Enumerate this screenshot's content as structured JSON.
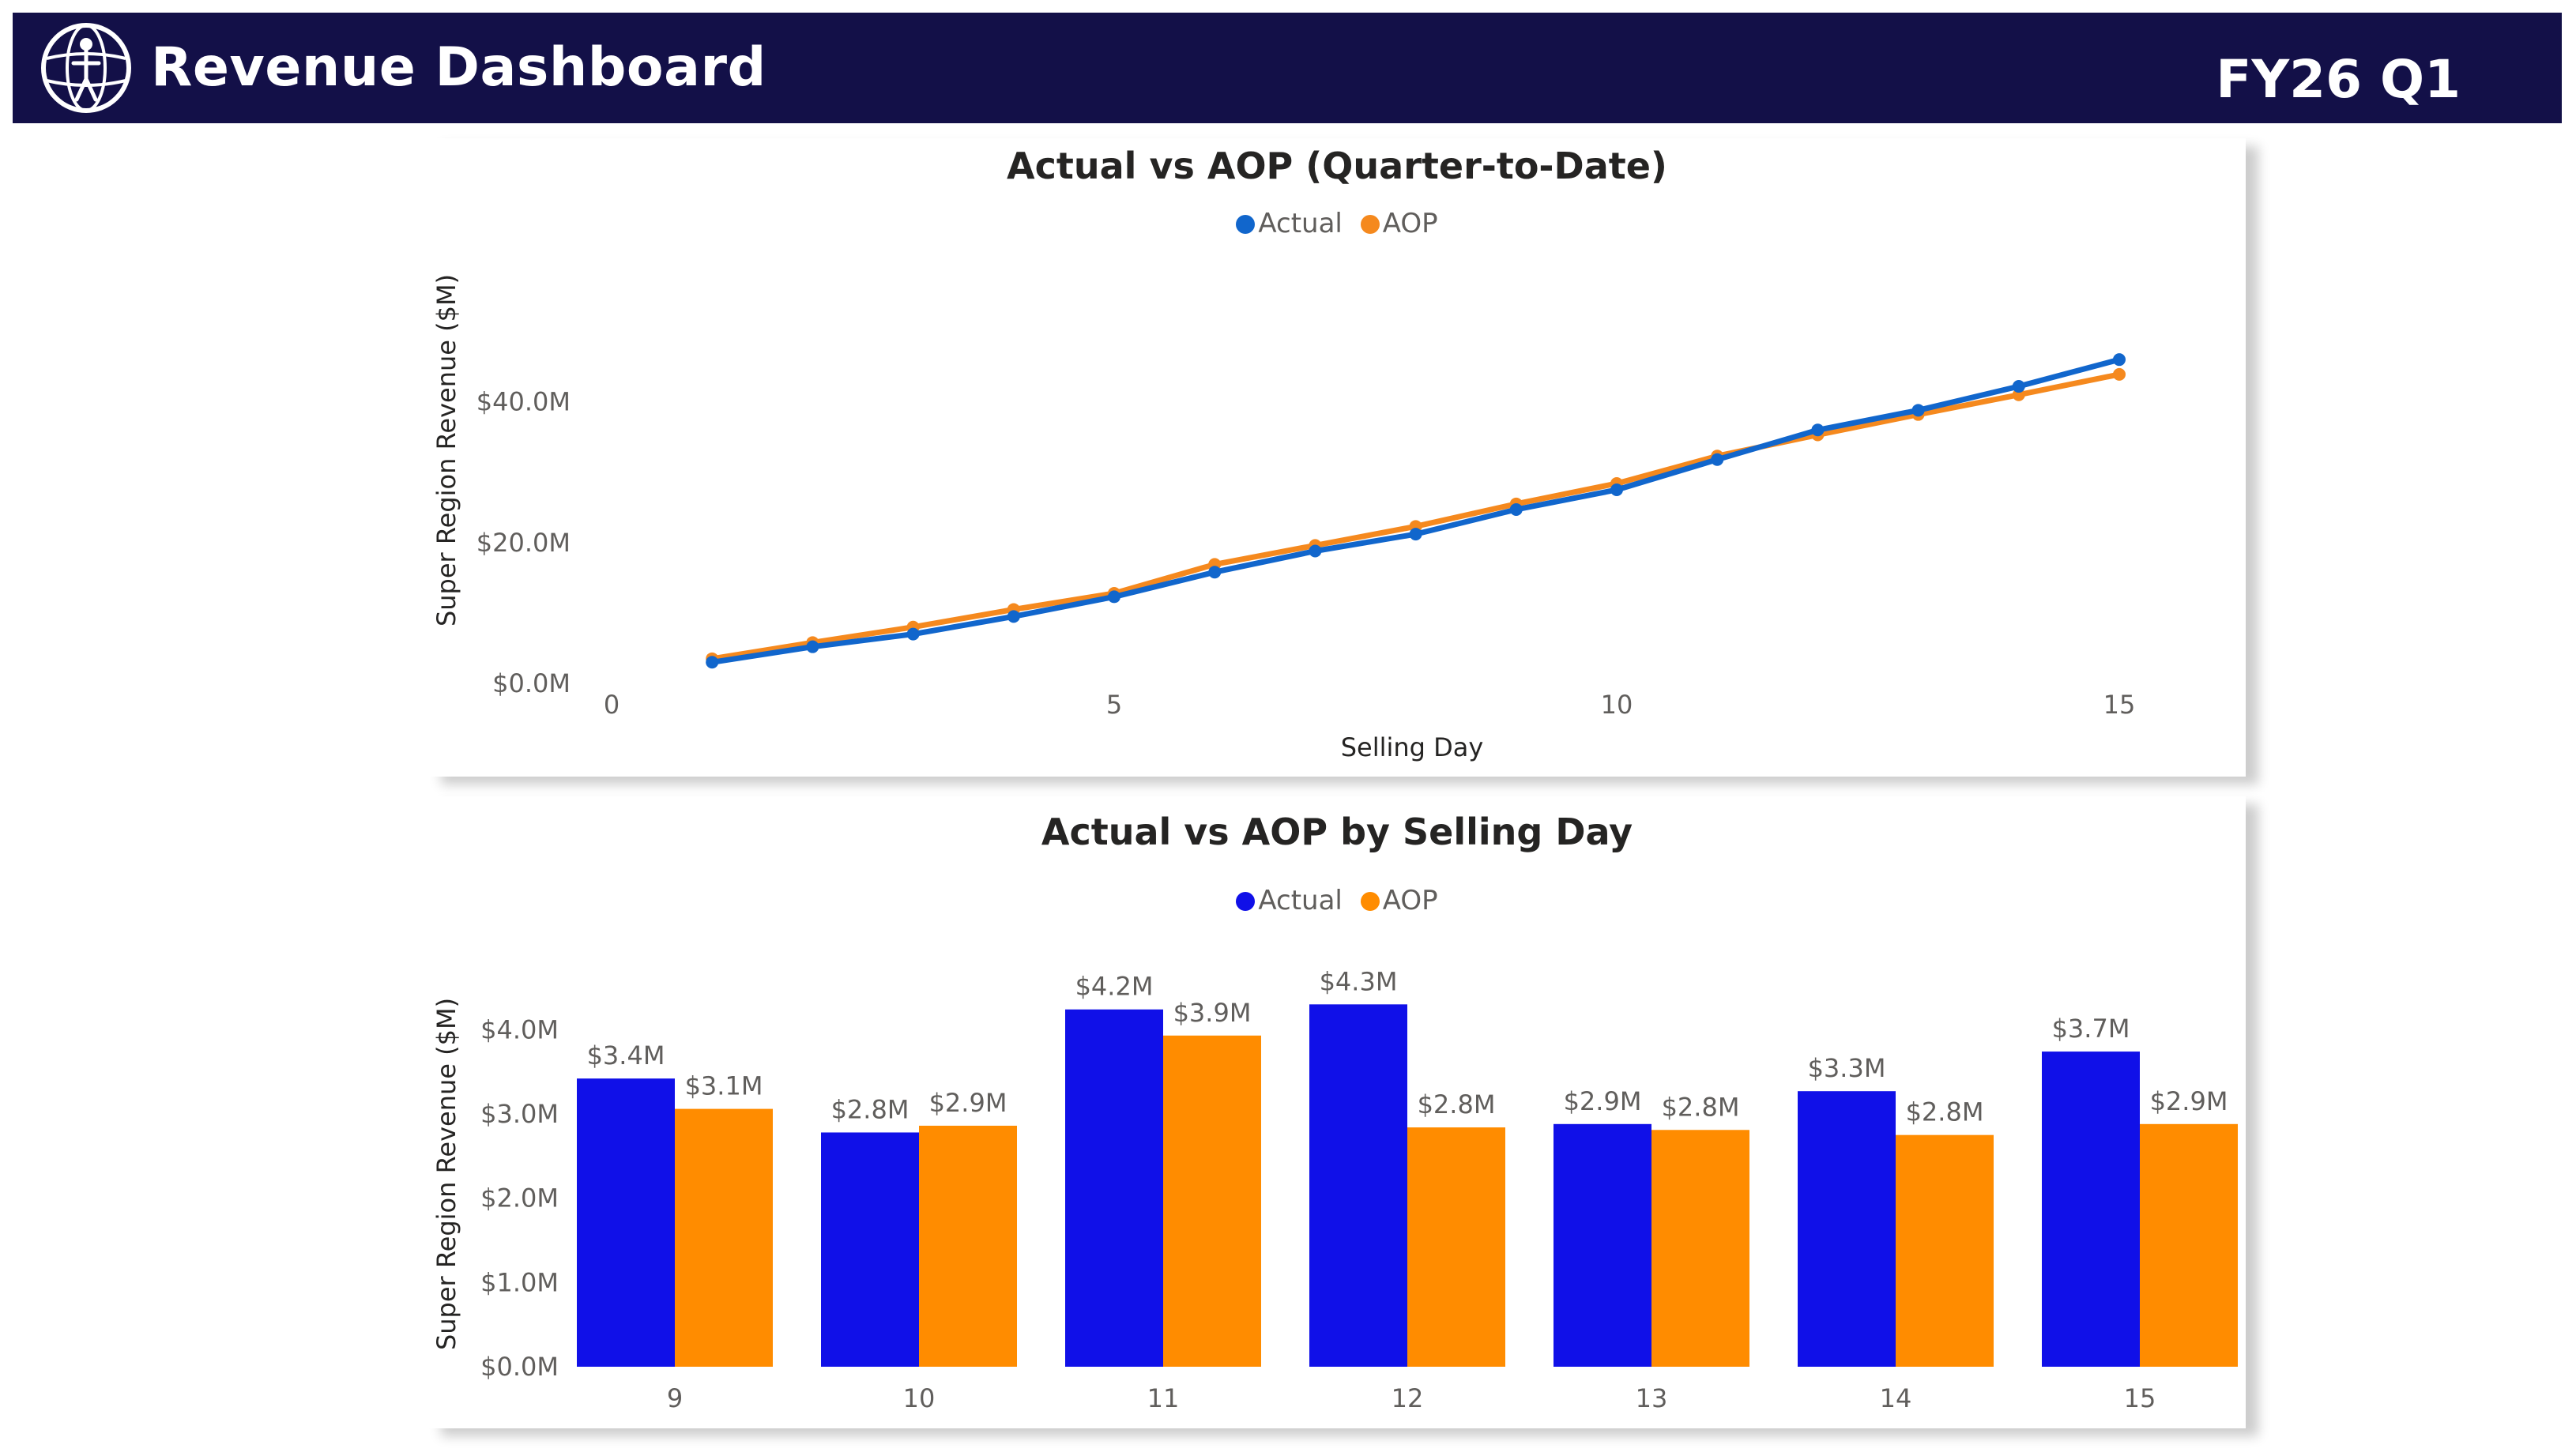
{
  "header": {
    "title": "Revenue Dashboard",
    "period": "FY26 Q1",
    "logo_icon": "globe-figure-logo-icon"
  },
  "colors": {
    "header_bg": "#131048",
    "line_actual": "#1166cc",
    "line_aop": "#f5891e",
    "bar_actual": "#1010e8",
    "bar_aop": "#ff8c00"
  },
  "chart_data": [
    {
      "type": "line",
      "title": "Actual vs AOP (Quarter-to-Date)",
      "xlabel": "Selling Day",
      "ylabel": "Super Region Revenue ($M)",
      "legend_position": "top-center",
      "x": [
        1,
        2,
        3,
        4,
        5,
        6,
        7,
        8,
        9,
        10,
        11,
        12,
        13,
        14,
        15
      ],
      "xlim": [
        0,
        15
      ],
      "xticks": [
        "0",
        "5",
        "10",
        "15"
      ],
      "ylim": [
        0,
        55
      ],
      "yticks": [
        "$0.0M",
        "$20.0M",
        "$40.0M"
      ],
      "series": [
        {
          "name": "Actual",
          "values": [
            3.0,
            5.2,
            7.0,
            9.5,
            12.3,
            15.8,
            18.8,
            21.2,
            24.7,
            27.5,
            31.8,
            36.0,
            38.8,
            42.2,
            46.0
          ]
        },
        {
          "name": "AOP",
          "values": [
            3.5,
            5.8,
            8.0,
            10.5,
            12.8,
            16.9,
            19.6,
            22.3,
            25.5,
            28.4,
            32.3,
            35.3,
            38.2,
            41.0,
            43.9
          ]
        }
      ]
    },
    {
      "type": "bar",
      "title": "Actual vs AOP by Selling Day",
      "xlabel": "",
      "ylabel": "Super Region Revenue ($M)",
      "legend_position": "top-center",
      "categories": [
        "9",
        "10",
        "11",
        "12",
        "13",
        "14",
        "15"
      ],
      "ylim": [
        0,
        4.8
      ],
      "yticks": [
        "$0.0M",
        "$1.0M",
        "$2.0M",
        "$3.0M",
        "$4.0M"
      ],
      "series": [
        {
          "name": "Actual",
          "values": [
            3.42,
            2.78,
            4.24,
            4.3,
            2.88,
            3.27,
            3.74
          ],
          "labels": [
            "$3.4M",
            "$2.8M",
            "$4.2M",
            "$4.3M",
            "$2.9M",
            "$3.3M",
            "$3.7M"
          ]
        },
        {
          "name": "AOP",
          "values": [
            3.06,
            2.86,
            3.93,
            2.84,
            2.81,
            2.75,
            2.88
          ],
          "labels": [
            "$3.1M",
            "$2.9M",
            "$3.9M",
            "$2.8M",
            "$2.8M",
            "$2.8M",
            "$2.9M"
          ]
        }
      ]
    }
  ]
}
